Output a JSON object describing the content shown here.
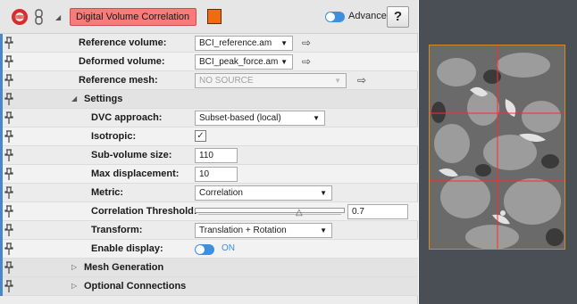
{
  "header": {
    "module_name": "Digital Volume Correlation",
    "module_icon": "red-ring-module-icon",
    "link_icon": "chain-link-icon",
    "color_swatch": "#f26b13",
    "advanced_label": "Advanced",
    "help_label": "?"
  },
  "ports": {
    "reference_volume": {
      "label": "Reference volume:",
      "value": "BCI_reference.am"
    },
    "deformed_volume": {
      "label": "Deformed volume:",
      "value": "BCI_peak_force.am"
    },
    "reference_mesh": {
      "label": "Reference mesh:",
      "value": "NO SOURCE"
    }
  },
  "settings": {
    "group_label": "Settings",
    "dvc_approach": {
      "label": "DVC approach:",
      "value": "Subset-based (local)"
    },
    "isotropic": {
      "label": "Isotropic:",
      "checked": true,
      "check_glyph": "✓"
    },
    "sub_volume_size": {
      "label": "Sub-volume size:",
      "value": "110"
    },
    "max_displacement": {
      "label": "Max displacement:",
      "value": "10"
    },
    "metric": {
      "label": "Metric:",
      "value": "Correlation"
    },
    "correlation_threshold": {
      "label": "Correlation Threshold:",
      "value": "0.7"
    },
    "transform": {
      "label": "Transform:",
      "value": "Translation + Rotation"
    },
    "enable_display": {
      "label": "Enable display:",
      "value": "ON"
    }
  },
  "groups": {
    "mesh_generation": "Mesh Generation",
    "optional_connections": "Optional Connections"
  },
  "colors": {
    "accent": "#3d8fe0",
    "title_bg": "#f87a7a",
    "grid": "#ff2a2a",
    "viewer_bg": "#4a4f56"
  }
}
